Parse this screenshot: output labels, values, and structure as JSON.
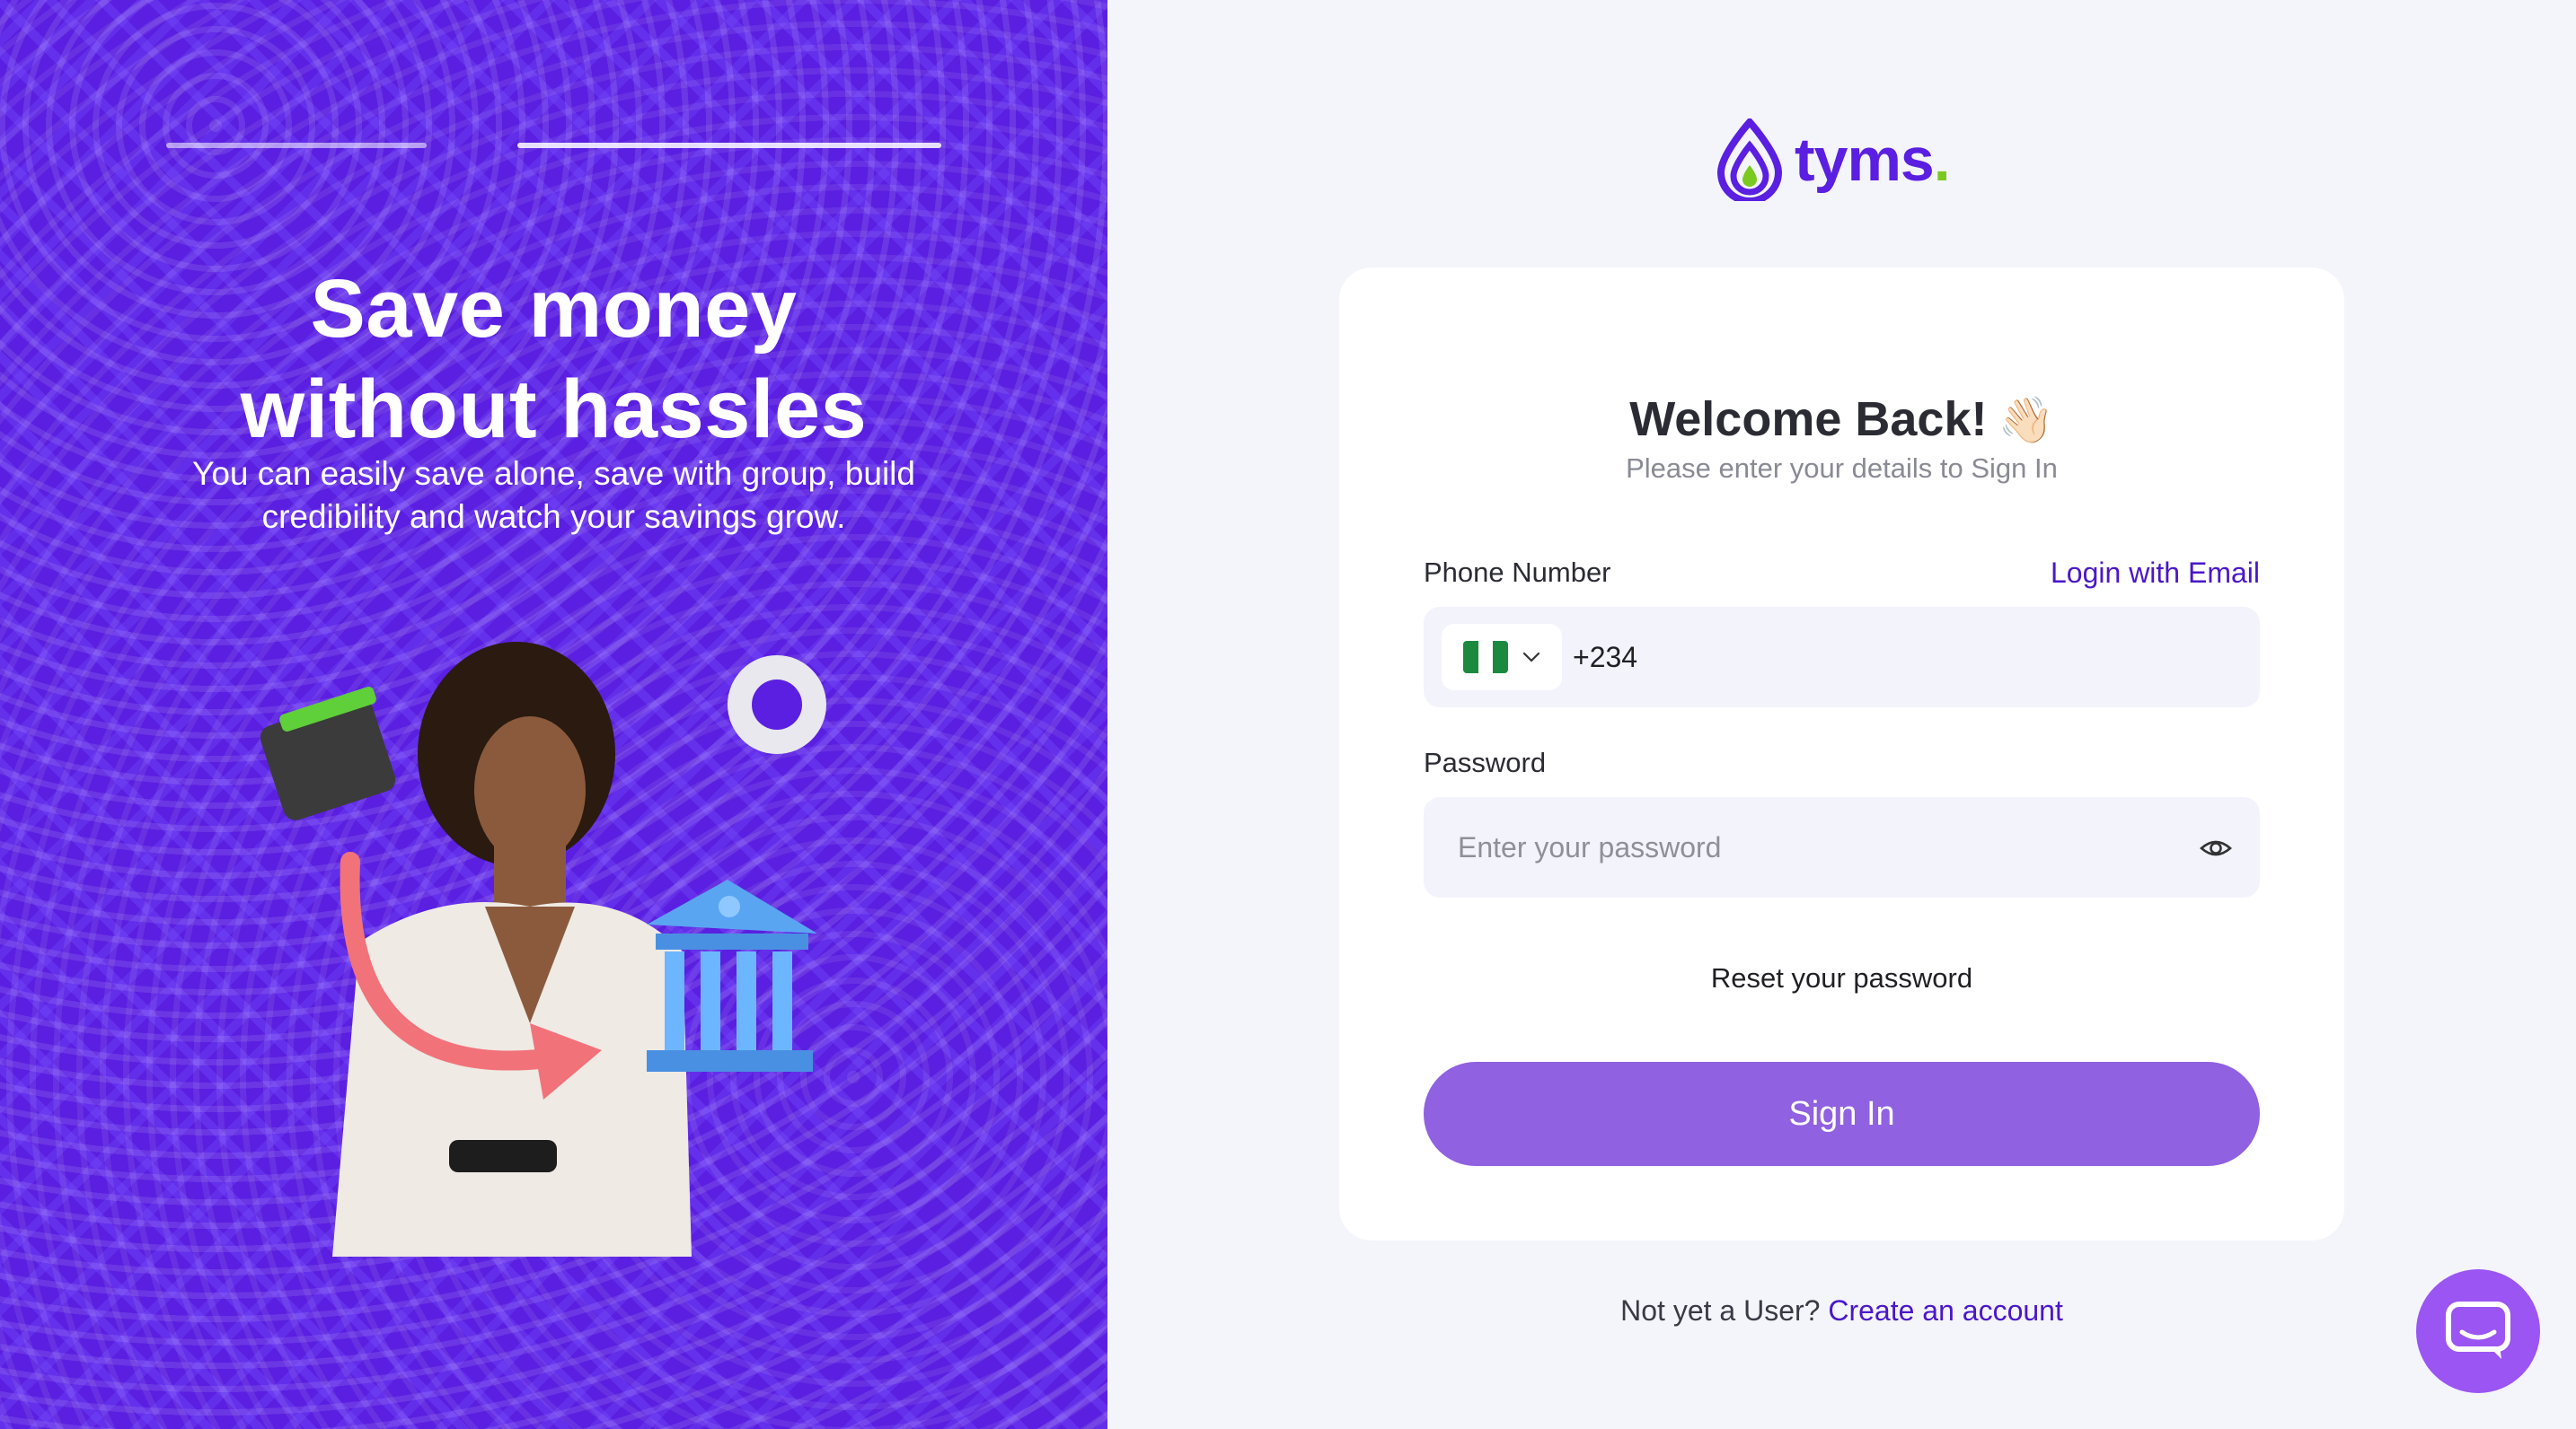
{
  "hero": {
    "title_line1": "Save money",
    "title_line2": "without hassles",
    "subtitle_line1": "You can easily save alone, save with group, build",
    "subtitle_line2": "credibility and watch your savings grow."
  },
  "brand": {
    "name": "tyms",
    "dot": "."
  },
  "login": {
    "welcome_title": "Welcome Back!",
    "welcome_emoji": "👋🏻",
    "welcome_subtitle": "Please enter your details to Sign In",
    "phone_label": "Phone Number",
    "login_with_email": "Login with Email",
    "country_code": "+234",
    "password_label": "Password",
    "password_placeholder": "Enter your password",
    "reset_password": "Reset your password",
    "sign_in": "Sign In"
  },
  "footer": {
    "prompt": "Not yet a User?",
    "create_account": "Create an account"
  },
  "colors": {
    "brand_purple": "#5a1fe0",
    "accent_green": "#7ac920",
    "button_purple": "#9061e0",
    "link_purple": "#4a17c9",
    "chat_purple": "#9b55f2"
  },
  "icons": [
    "logo-drop-icon",
    "nigeria-flag-icon",
    "chevron-down-icon",
    "eye-icon",
    "chat-icon"
  ]
}
